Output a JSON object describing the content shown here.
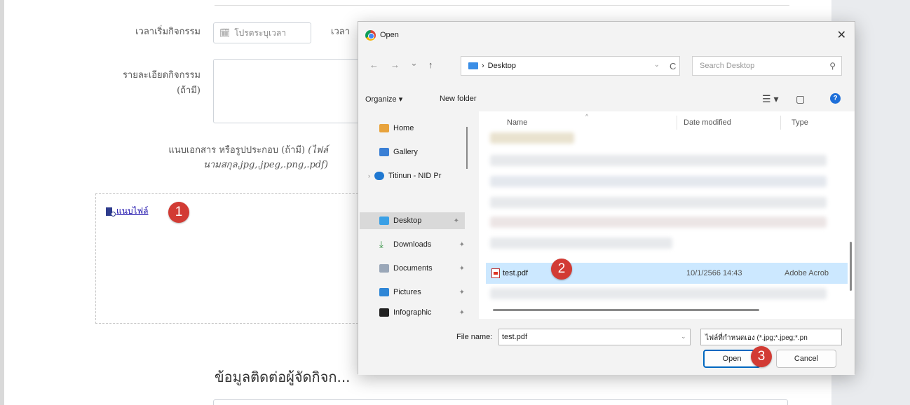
{
  "form": {
    "start_time_label": "เวลาเริ่มกิจกรรม",
    "date_placeholder": "โปรดระบุเวลา",
    "end_time_label_partial": "เวลา",
    "details_label_line1": "รายละเอียดกิจกรรม",
    "details_label_line2": "(ถ้ามี)",
    "attach_hint_line1": "แนบเอกสาร หรือรูปประกอบ (ถ้ามี) ",
    "attach_hint_line1_italic": "(ไฟล์",
    "attach_hint_line2": "นามสกุล.jpg,.jpeg,.png,.pdf)",
    "attach_link": "แนบไฟล์",
    "section_title": "ข้อมูลติดต่อผู้จัดกิจก..."
  },
  "badges": {
    "step1": "1",
    "step2": "2",
    "step3": "3"
  },
  "dialog": {
    "title": "Open",
    "close": "✕",
    "nav": {
      "back": "←",
      "forward": "→",
      "recent": "⌄",
      "up": "↑",
      "refresh": "C"
    },
    "address": {
      "separator": "›",
      "folder": "Desktop"
    },
    "search_placeholder": "Search Desktop",
    "toolbar": {
      "organize": "Organize ▾",
      "new_folder": "New folder",
      "view": "☰ ▾",
      "pane": "▢",
      "help": "?"
    },
    "sidebar": [
      {
        "label": "Home"
      },
      {
        "label": "Gallery"
      },
      {
        "label": "Titinun - NID Pr"
      },
      {
        "label": "Desktop"
      },
      {
        "label": "Downloads"
      },
      {
        "label": "Documents"
      },
      {
        "label": "Pictures"
      },
      {
        "label": "Infographic"
      }
    ],
    "columns": {
      "name": "Name",
      "date_modified": "Date modified",
      "type": "Type"
    },
    "selected_file": {
      "name": "test.pdf",
      "date": "10/1/2566 14:43",
      "type": "Adobe Acrob"
    },
    "file_name_label": "File name:",
    "file_name_value": "test.pdf",
    "file_type_filter": "ไฟล์ที่กำหนดเอง (*.jpg;*.jpeg;*.pn",
    "open_button": "Open",
    "cancel_button": "Cancel"
  },
  "colors": {
    "badge": "#d23b34",
    "selection": "#cce8ff",
    "primary_border": "#0067c0"
  }
}
